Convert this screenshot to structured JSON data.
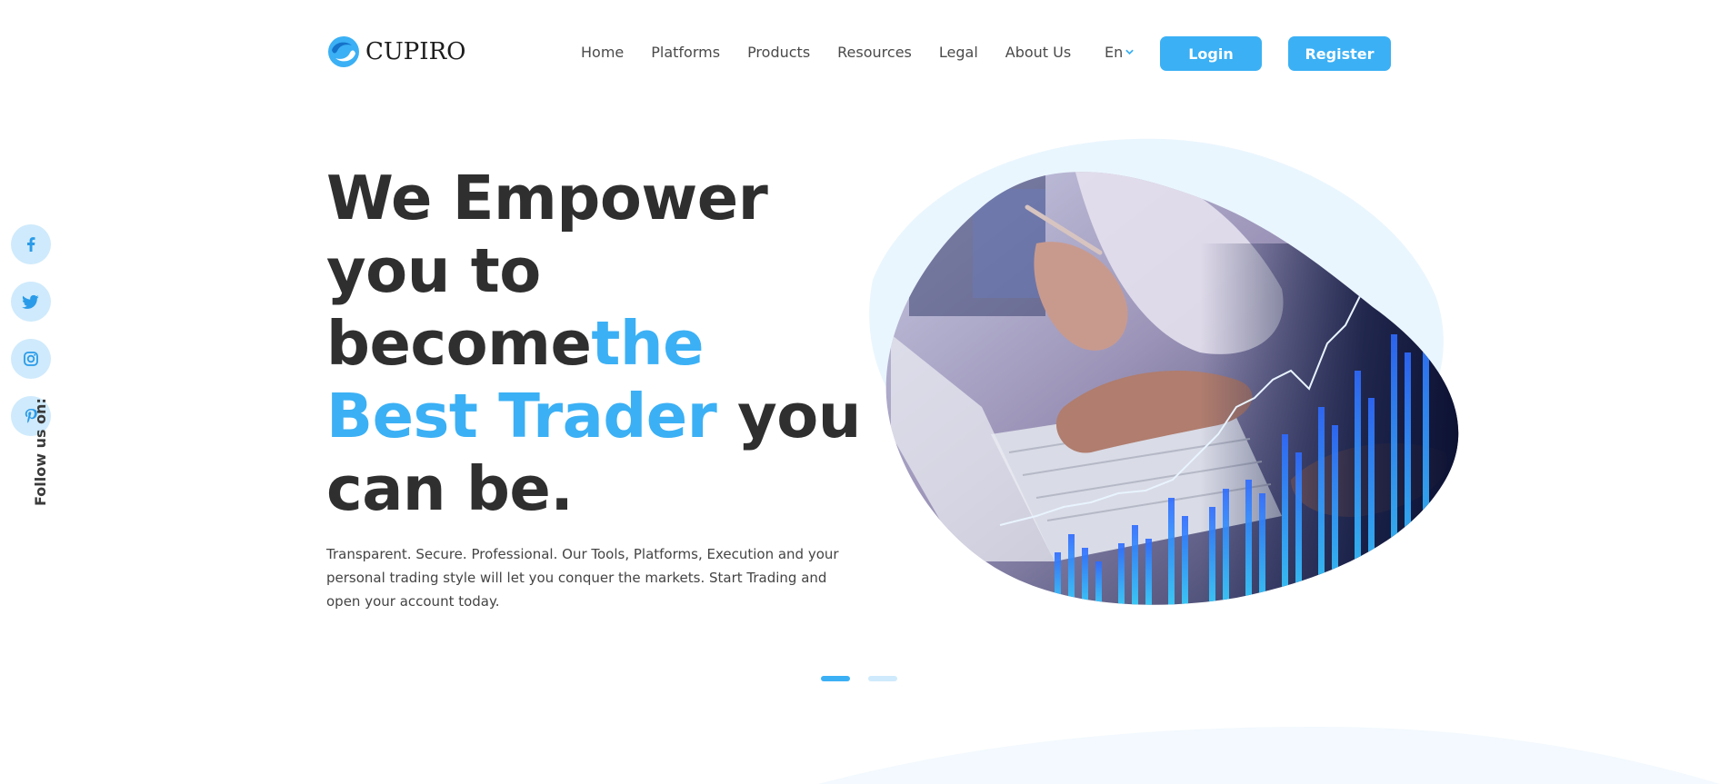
{
  "brand": {
    "name": "CUPIRO",
    "color": "#3bb0f5"
  },
  "nav": {
    "items": [
      "Home",
      "Platforms",
      "Products",
      "Resources",
      "Legal",
      "About Us"
    ],
    "language": "En",
    "login_label": "Login",
    "register_label": "Register"
  },
  "social": {
    "icons": [
      "facebook-icon",
      "twitter-icon",
      "instagram-icon",
      "pinterest-icon"
    ],
    "follow_label": "Follow us on:"
  },
  "hero": {
    "headline_part1": "We Empower you to become",
    "headline_accent": "the Best Trader",
    "headline_part2": " you can be.",
    "subtext": "Transparent. Secure. Professional. Our Tools, Platforms, Execution and your personal trading style will let you conquer the markets. Start Trading and open your account today.",
    "image": "trading-hands-keyboard-chart-image"
  },
  "slider": {
    "slide_count": 2,
    "active_slide": 1
  }
}
